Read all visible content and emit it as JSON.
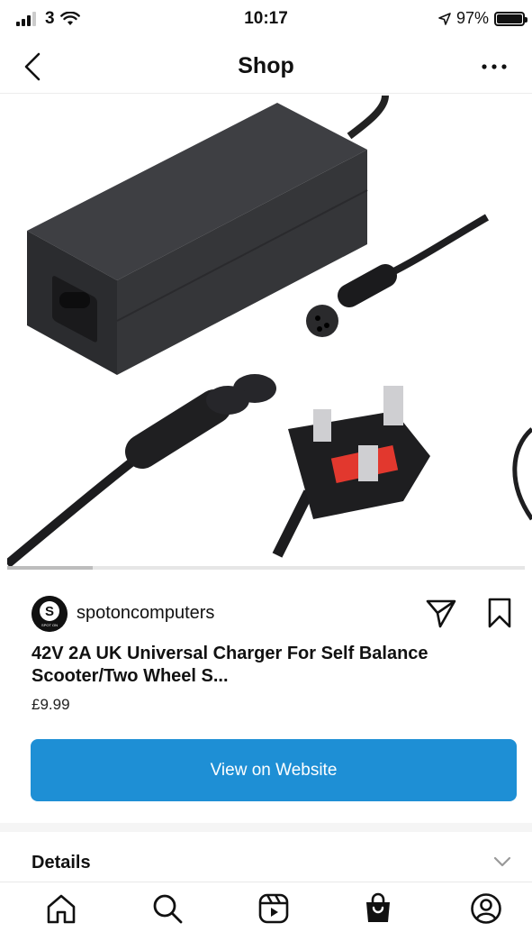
{
  "status_bar": {
    "carrier": "3",
    "time": "10:17",
    "battery": "97%"
  },
  "nav": {
    "title": "Shop",
    "back_icon": "chevron-left-icon",
    "more_icon": "more-horizontal-icon"
  },
  "product": {
    "image_alt": "power-adapter-with-uk-plug",
    "seller": "spotoncomputers",
    "avatar_text": "SPOT ON computers",
    "title": "42V 2A UK Universal Charger For Self Balance Scooter/Two Wheel S...",
    "price": "£9.99",
    "cta_label": "View on Website"
  },
  "details": {
    "label": "Details"
  },
  "tabs": [
    {
      "name": "home",
      "icon": "home-icon"
    },
    {
      "name": "search",
      "icon": "search-icon"
    },
    {
      "name": "reels",
      "icon": "reels-icon"
    },
    {
      "name": "shop",
      "icon": "shop-bag-icon"
    },
    {
      "name": "profile",
      "icon": "profile-icon"
    }
  ],
  "colors": {
    "accent": "#1e8fd5",
    "text": "#111111",
    "divider": "#ececec"
  }
}
